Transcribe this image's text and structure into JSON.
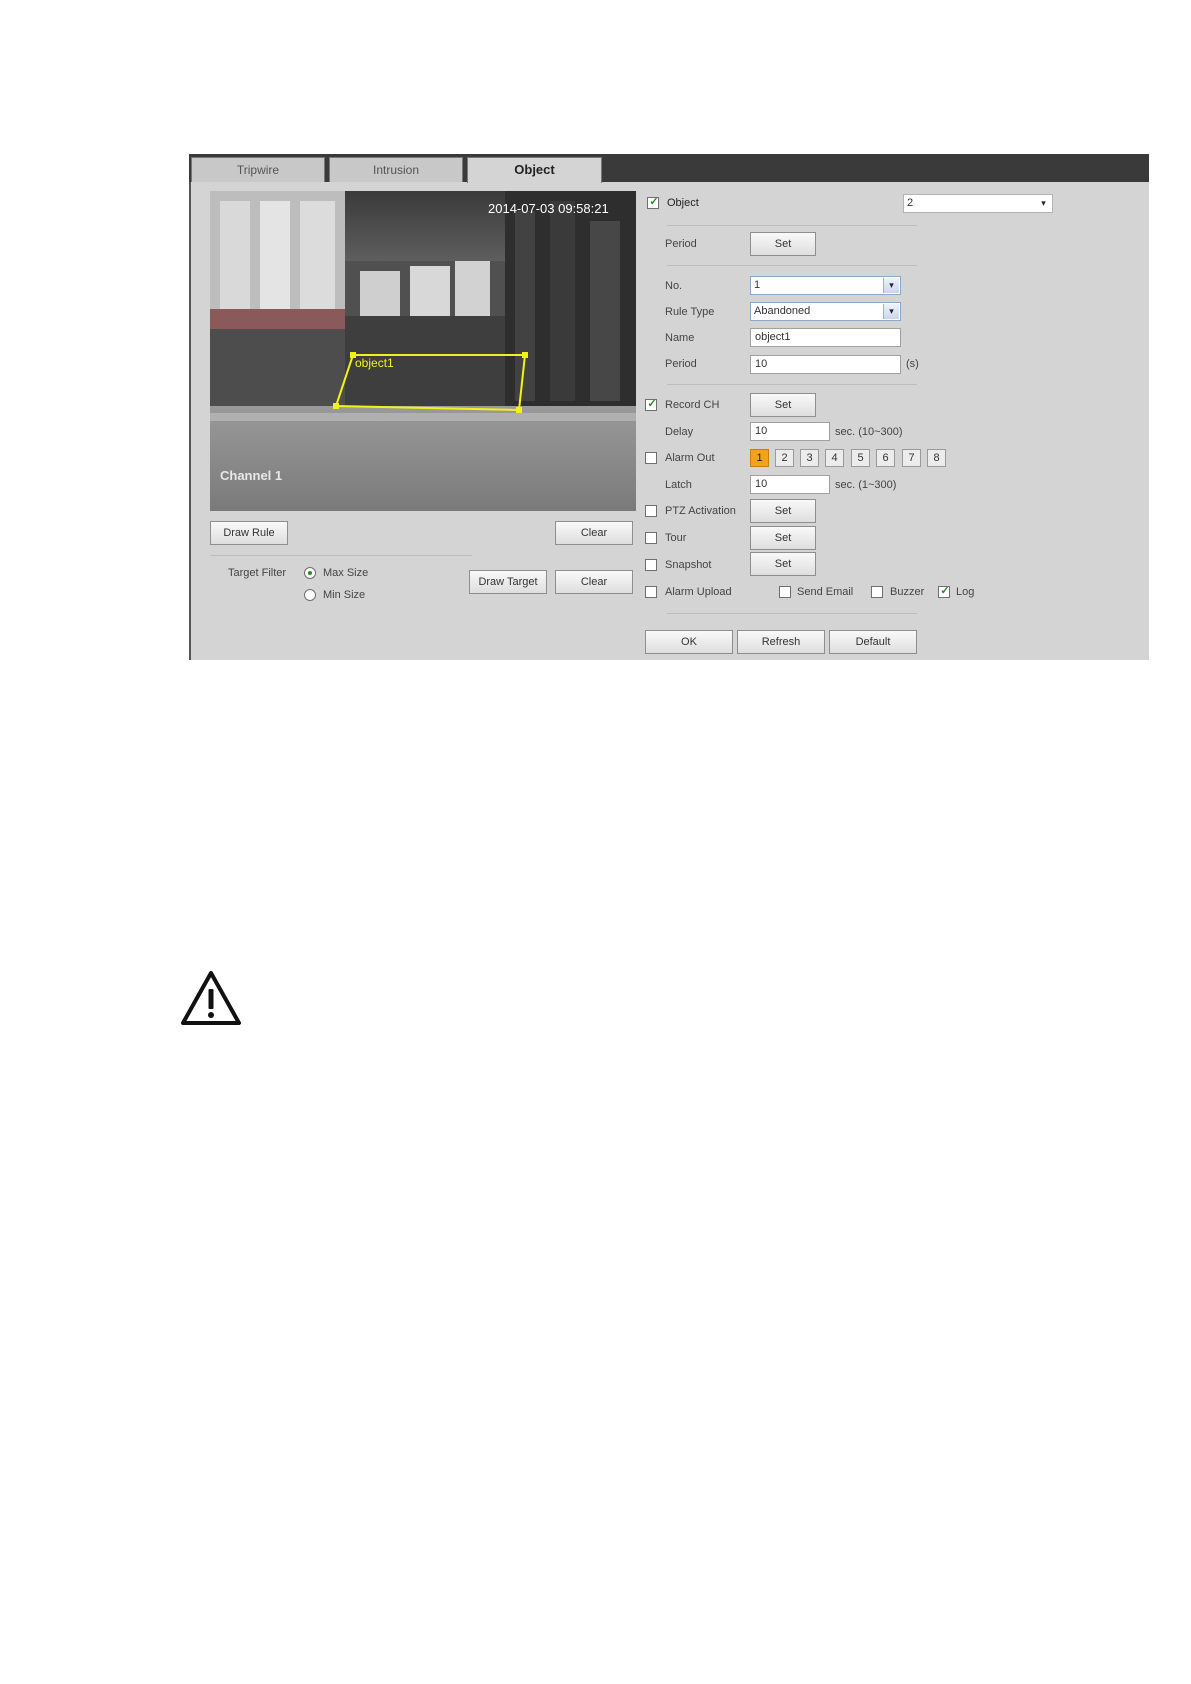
{
  "tabs": [
    {
      "label": "Tripwire"
    },
    {
      "label": "Intrusion"
    },
    {
      "label": "Object"
    }
  ],
  "video": {
    "timestamp": "2014-07-03 09:58:21",
    "channel_label": "Channel 1",
    "object_label": "object1",
    "rule_color": "#f2f21a"
  },
  "left_buttons": {
    "draw_rule": "Draw Rule",
    "clear": "Clear",
    "draw_target": "Draw Target",
    "clear2": "Clear"
  },
  "target_filter": {
    "label": "Target Filter",
    "options": [
      {
        "label": "Max Size",
        "selected": true
      },
      {
        "label": "Min Size",
        "selected": false
      }
    ]
  },
  "form": {
    "object": {
      "label": "Object",
      "checked": true,
      "value": "2"
    },
    "period_top": {
      "label": "Period",
      "button": "Set"
    },
    "no": {
      "label": "No.",
      "value": "1"
    },
    "rule_type": {
      "label": "Rule Type",
      "value": "Abandoned"
    },
    "name": {
      "label": "Name",
      "value": "object1"
    },
    "period": {
      "label": "Period",
      "value": "10",
      "unit": "(s)"
    },
    "record_ch": {
      "label": "Record CH",
      "checked": true,
      "button": "Set"
    },
    "delay": {
      "label": "Delay",
      "value": "10",
      "hint": "sec. (10~300)"
    },
    "alarm_out": {
      "label": "Alarm Out",
      "checked": false,
      "channels": [
        "1",
        "2",
        "3",
        "4",
        "5",
        "6",
        "7",
        "8"
      ],
      "active": "1"
    },
    "latch": {
      "label": "Latch",
      "value": "10",
      "hint": "sec. (1~300)"
    },
    "ptz_activation": {
      "label": "PTZ Activation",
      "checked": false,
      "button": "Set"
    },
    "tour": {
      "label": "Tour",
      "checked": false,
      "button": "Set"
    },
    "snapshot": {
      "label": "Snapshot",
      "checked": false,
      "button": "Set"
    },
    "alarm_upload": {
      "label": "Alarm Upload",
      "checked": false
    },
    "send_email": {
      "label": "Send Email",
      "checked": false
    },
    "buzzer": {
      "label": "Buzzer",
      "checked": false
    },
    "log": {
      "label": "Log",
      "checked": true
    }
  },
  "footer": {
    "ok": "OK",
    "refresh": "Refresh",
    "default": "Default"
  },
  "warning_icon": "warning-triangle-icon"
}
